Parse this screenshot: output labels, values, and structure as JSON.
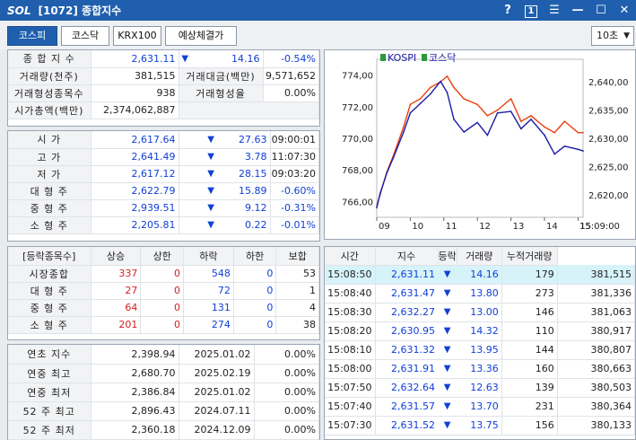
{
  "window": {
    "logo": "SOL",
    "title": "[1072] 종합지수",
    "help": "?",
    "num": "1",
    "menu": "☰",
    "min": "—",
    "max": "☐",
    "close": "✕"
  },
  "tabs": [
    {
      "label": "코스피"
    },
    {
      "label": "코스닥"
    },
    {
      "label": "KRX100"
    },
    {
      "label": "예상체결가"
    }
  ],
  "interval": "10초",
  "summary": {
    "r1": {
      "label": "종 합 지 수",
      "value": "2,631.11",
      "arrow": "▼",
      "change": "14.16",
      "pct": "-0.54%"
    },
    "r2": {
      "label1": "거래량(천주)",
      "value1": "381,515",
      "label2": "거래대금(백만)",
      "value2": "9,571,652"
    },
    "r3": {
      "label1": "거래형성종목수",
      "value1": "938",
      "label2": "거래형성율",
      "value2": "0.00%"
    },
    "r4": {
      "label": "시가총액(백만)",
      "value": "2,374,062,887"
    }
  },
  "prices": [
    {
      "label": "시 가",
      "value": "2,617.64",
      "arrow": "▼",
      "change": "27.63",
      "extra": "09:00:01"
    },
    {
      "label": "고 가",
      "value": "2,641.49",
      "arrow": "▼",
      "change": "3.78",
      "extra": "11:07:30"
    },
    {
      "label": "저 가",
      "value": "2,617.12",
      "arrow": "▼",
      "change": "28.15",
      "extra": "09:03:20"
    },
    {
      "label": "대 형 주",
      "value": "2,622.79",
      "arrow": "▼",
      "change": "15.89",
      "extra": "-0.60%"
    },
    {
      "label": "중 형 주",
      "value": "2,939.51",
      "arrow": "▼",
      "change": "9.12",
      "extra": "-0.31%"
    },
    {
      "label": "소 형 주",
      "value": "2,205.81",
      "arrow": "▼",
      "change": "0.22",
      "extra": "-0.01%"
    }
  ],
  "breadth": {
    "headers": [
      "[등락종목수]",
      "상승",
      "상한",
      "하락",
      "하한",
      "보합"
    ],
    "rows": [
      {
        "label": "시장종합",
        "up": "337",
        "upper": "0",
        "down": "548",
        "lower": "0",
        "flat": "53"
      },
      {
        "label": "대 형 주",
        "up": "27",
        "upper": "0",
        "down": "72",
        "lower": "0",
        "flat": "1"
      },
      {
        "label": "중 형 주",
        "up": "64",
        "upper": "0",
        "down": "131",
        "lower": "0",
        "flat": "4"
      },
      {
        "label": "소 형 주",
        "up": "201",
        "upper": "0",
        "down": "274",
        "lower": "0",
        "flat": "38"
      }
    ]
  },
  "history": [
    {
      "label": "연초 지수",
      "value": "2,398.94",
      "date": "2025.01.02",
      "pct": "0.00%"
    },
    {
      "label": "연중 최고",
      "value": "2,680.70",
      "date": "2025.02.19",
      "pct": "0.00%"
    },
    {
      "label": "연중 최저",
      "value": "2,386.84",
      "date": "2025.01.02",
      "pct": "0.00%"
    },
    {
      "label": "52 주 최고",
      "value": "2,896.43",
      "date": "2024.07.11",
      "pct": "0.00%"
    },
    {
      "label": "52 주 최저",
      "value": "2,360.18",
      "date": "2024.12.09",
      "pct": "0.00%"
    }
  ],
  "ticks": {
    "headers": [
      "시간",
      "지수",
      "등락",
      "거래량",
      "누적거래량"
    ],
    "rows": [
      {
        "time": "15:08:50",
        "index": "2,631.11",
        "change": "14.16",
        "vol": "179",
        "cum": "381,515"
      },
      {
        "time": "15:08:40",
        "index": "2,631.47",
        "change": "13.80",
        "vol": "273",
        "cum": "381,336"
      },
      {
        "time": "15:08:30",
        "index": "2,632.27",
        "change": "13.00",
        "vol": "146",
        "cum": "381,063"
      },
      {
        "time": "15:08:20",
        "index": "2,630.95",
        "change": "14.32",
        "vol": "110",
        "cum": "380,917"
      },
      {
        "time": "15:08:10",
        "index": "2,631.32",
        "change": "13.95",
        "vol": "144",
        "cum": "380,807"
      },
      {
        "time": "15:08:00",
        "index": "2,631.91",
        "change": "13.36",
        "vol": "160",
        "cum": "380,663"
      },
      {
        "time": "15:07:50",
        "index": "2,632.64",
        "change": "12.63",
        "vol": "139",
        "cum": "380,503"
      },
      {
        "time": "15:07:40",
        "index": "2,631.57",
        "change": "13.70",
        "vol": "231",
        "cum": "380,364"
      },
      {
        "time": "15:07:30",
        "index": "2,631.52",
        "change": "13.75",
        "vol": "156",
        "cum": "380,133"
      }
    ]
  },
  "chart_data": {
    "type": "line",
    "legend": [
      "KOSPI",
      "코스닥"
    ],
    "x_ticks": [
      "09",
      "10",
      "11",
      "12",
      "13",
      "14",
      "15"
    ],
    "last_time": "15:09:00",
    "left_axis": {
      "ticks": [
        "774,00",
        "772,00",
        "770,00",
        "768,00",
        "766,00"
      ],
      "range": [
        765,
        775
      ]
    },
    "right_axis": {
      "ticks": [
        "2,640,00",
        "2,635,00",
        "2,630,00",
        "2,625,00",
        "2,620,00"
      ],
      "range": [
        2616,
        2644
      ]
    },
    "series": [
      {
        "name": "KOSPI",
        "color": "#e8400c",
        "axis": "right",
        "hours": [
          9,
          9.1,
          9.3,
          9.5,
          9.8,
          10,
          10.3,
          10.6,
          10.9,
          11.1,
          11.3,
          11.6,
          12,
          12.3,
          12.6,
          13,
          13.3,
          13.6,
          14,
          14.3,
          14.6,
          15,
          15.15
        ],
        "values": [
          2618,
          2620,
          2624,
          2627,
          2632,
          2636,
          2637,
          2639,
          2640,
          2641,
          2639,
          2637,
          2636,
          2634,
          2635,
          2637,
          2633,
          2634,
          2632,
          2631,
          2633,
          2631,
          2631
        ]
      },
      {
        "name": "코스닥",
        "color": "#1a1aa8",
        "axis": "left",
        "hours": [
          9,
          9.1,
          9.3,
          9.5,
          9.8,
          10,
          10.3,
          10.6,
          10.9,
          11.1,
          11.3,
          11.6,
          12,
          12.3,
          12.6,
          13,
          13.3,
          13.6,
          14,
          14.3,
          14.6,
          15,
          15.15
        ],
        "values": [
          765.6,
          766.5,
          767.8,
          768.8,
          770.4,
          771.6,
          772.2,
          772.8,
          773.6,
          772.9,
          771.2,
          770.4,
          771.0,
          770.2,
          771.6,
          771.7,
          770.6,
          771.2,
          770.2,
          769.0,
          769.5,
          769.3,
          769.2
        ]
      }
    ]
  },
  "colors": {
    "accent": "#1f5fae",
    "up": "#d42020",
    "down": "#1040d8",
    "highlight": "#d7f3fa"
  }
}
